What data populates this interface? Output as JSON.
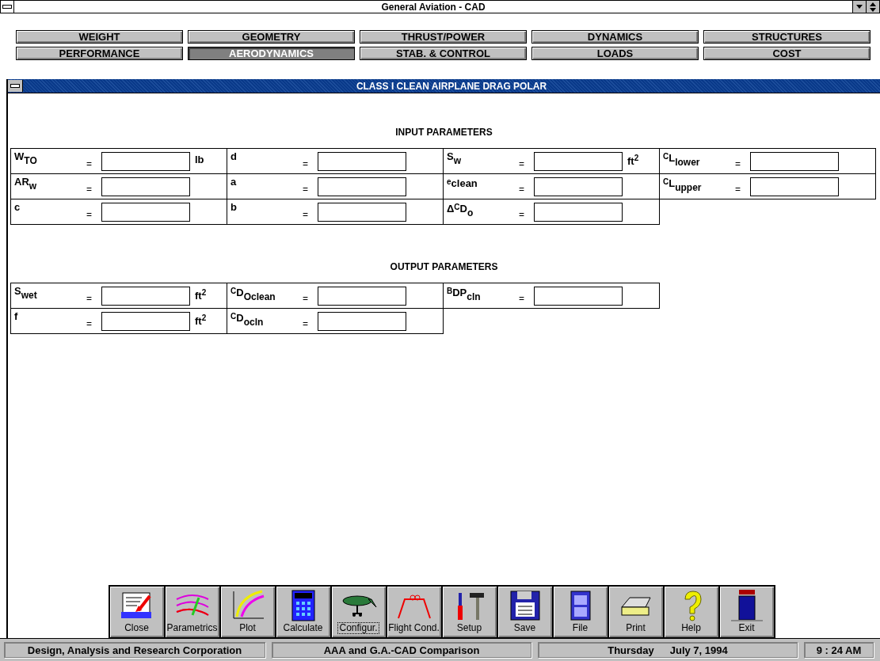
{
  "window": {
    "title": "General Aviation - CAD"
  },
  "tabs": [
    {
      "label": "WEIGHT",
      "selected": false
    },
    {
      "label": "GEOMETRY",
      "selected": false
    },
    {
      "label": "THRUST/POWER",
      "selected": false
    },
    {
      "label": "DYNAMICS",
      "selected": false
    },
    {
      "label": "STRUCTURES",
      "selected": false
    },
    {
      "label": "PERFORMANCE",
      "selected": false
    },
    {
      "label": "AERODYNAMICS",
      "selected": true
    },
    {
      "label": "STAB. & CONTROL",
      "selected": false
    },
    {
      "label": "LOADS",
      "selected": false
    },
    {
      "label": "COST",
      "selected": false
    }
  ],
  "child_window": {
    "title": "CLASS I CLEAN AIRPLANE DRAG POLAR"
  },
  "sections": [
    {
      "heading": "INPUT PARAMETERS",
      "rows": [
        [
          {
            "label": "W$_{TO}$",
            "unit": "lb"
          },
          {
            "label": "d"
          },
          {
            "label": "S$_{w}$",
            "unit": "ft$^{2}$"
          },
          {
            "label": "$^{C}$L$_{lower}$"
          }
        ],
        [
          {
            "label": "AR$_{w}$"
          },
          {
            "label": "a"
          },
          {
            "label": "$^{e}$clean"
          },
          {
            "label": "$^{C}$L$_{upper}$"
          }
        ],
        [
          {
            "label": "c"
          },
          {
            "label": "b"
          },
          {
            "label": "Δ$^{C}$D$_{o}$"
          }
        ]
      ]
    },
    {
      "heading": "OUTPUT PARAMETERS",
      "rows": [
        [
          {
            "label": "S$_{wet}$",
            "unit": "ft$^{2}$"
          },
          {
            "label": "$^{C}$D$_{Oclean}$"
          },
          {
            "label": "$^{B}$DP$_{cln}$"
          }
        ],
        [
          {
            "label": "f",
            "unit": "ft$^{2}$"
          },
          {
            "label": "$^{C}$D$_{ocln}$"
          }
        ]
      ]
    }
  ],
  "equals": "=",
  "toolbar": [
    {
      "label": "Close",
      "focused": false
    },
    {
      "label": "Parametrics",
      "focused": false
    },
    {
      "label": "Plot",
      "focused": false
    },
    {
      "label": "Calculate",
      "focused": false
    },
    {
      "label": "Configur.",
      "focused": true
    },
    {
      "label": "Flight Cond.",
      "focused": false
    },
    {
      "label": "Setup",
      "focused": false
    },
    {
      "label": "Save",
      "focused": false
    },
    {
      "label": "File",
      "focused": false
    },
    {
      "label": "Print",
      "focused": false
    },
    {
      "label": "Help",
      "focused": false
    },
    {
      "label": "Exit",
      "focused": false
    }
  ],
  "status_bar": {
    "company": "Design, Analysis and Research Corporation",
    "document": "AAA and G.A.-CAD Comparison",
    "day": "Thursday",
    "date": "July 7, 1994",
    "time": "9 : 24 AM"
  }
}
